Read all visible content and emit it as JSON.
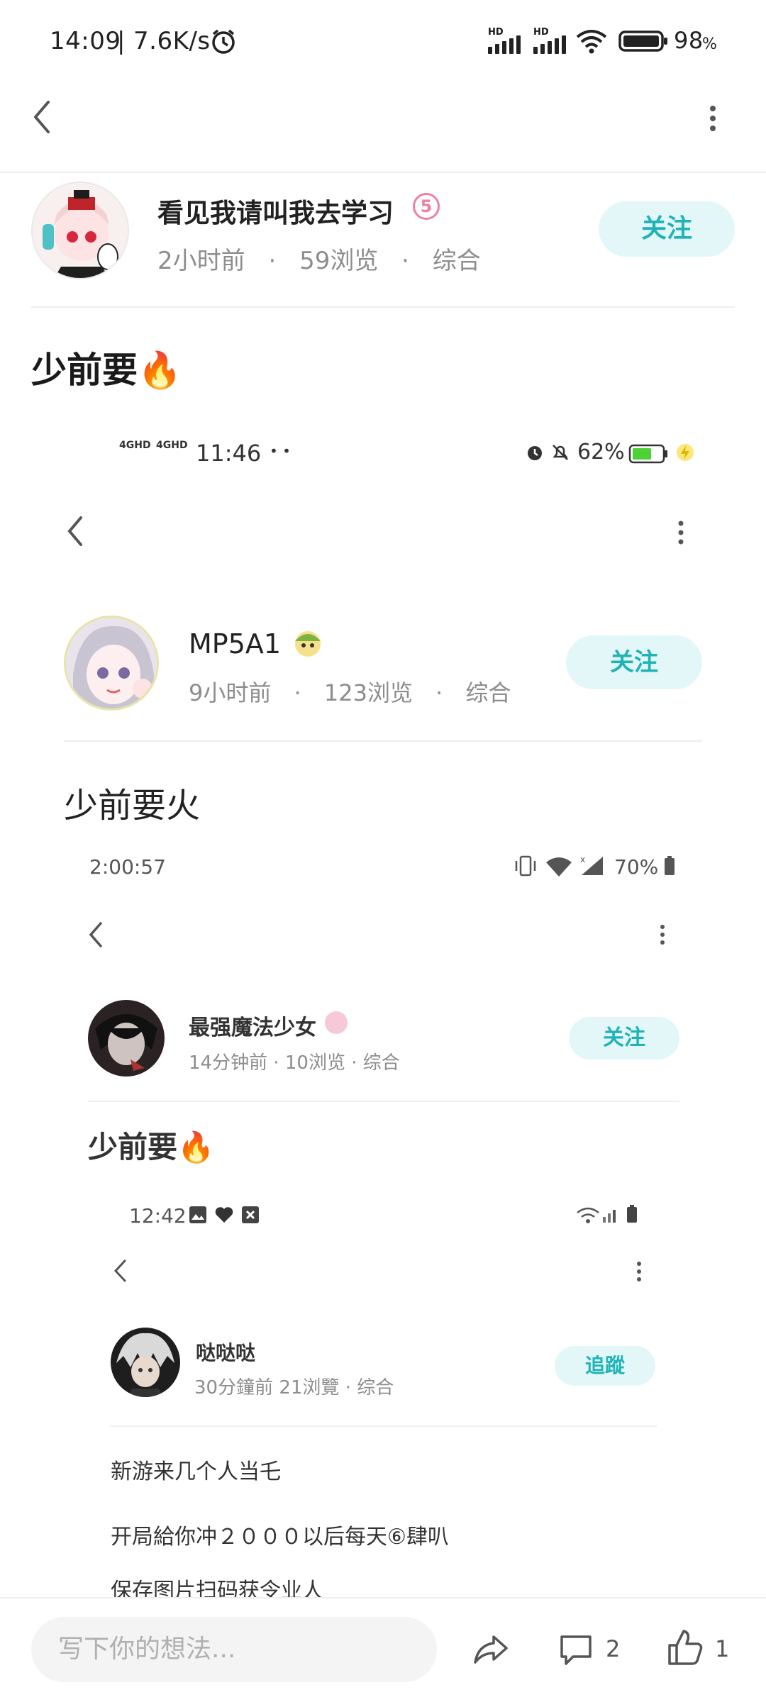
{
  "status_bar": {
    "time": "14:09",
    "speed": "7.6K/s",
    "hd1": "HD",
    "hd2": "HD",
    "battery_value": "98",
    "battery_unit": "%"
  },
  "post": {
    "author": "看见我请叫我去学习",
    "level": "5",
    "time": "2小时前",
    "views": "59浏览",
    "category": "综合",
    "follow_label": "关注",
    "title": "少前要🔥",
    "sep": "·"
  },
  "screenshot1": {
    "status_net1": "4GHD",
    "status_net2": "4GHD",
    "time": "11:46",
    "dots": "• •",
    "battery": "62%",
    "author": "MP5A1",
    "time_ago": "9小时前",
    "views": "123浏览",
    "category": "综合",
    "follow_label": "关注",
    "title": "少前要火"
  },
  "screenshot2": {
    "time": "2:00:57",
    "battery": "70%",
    "author": "最强魔法少女",
    "meta": "14分钟前 · 10浏览 · 综合",
    "follow_label": "关注",
    "title": "少前要🔥"
  },
  "screenshot3": {
    "time": "12:42",
    "author": "哒哒哒",
    "meta": "30分鐘前 21浏覽 · 综合",
    "follow_label": "追蹤",
    "line1": "新游来几个人当乇",
    "line2": "开局給你冲２０００以后每天⑥肆叭",
    "line3": "保存图片扫码获令业人"
  },
  "bottom_bar": {
    "placeholder": "写下你的想法...",
    "comment_count": "2",
    "like_count": "1"
  },
  "colors": {
    "accent": "#1fb3b8",
    "follow_bg": "#e3f7f8",
    "meta": "#8d8d8d",
    "level_badge": "#f07fa0"
  }
}
